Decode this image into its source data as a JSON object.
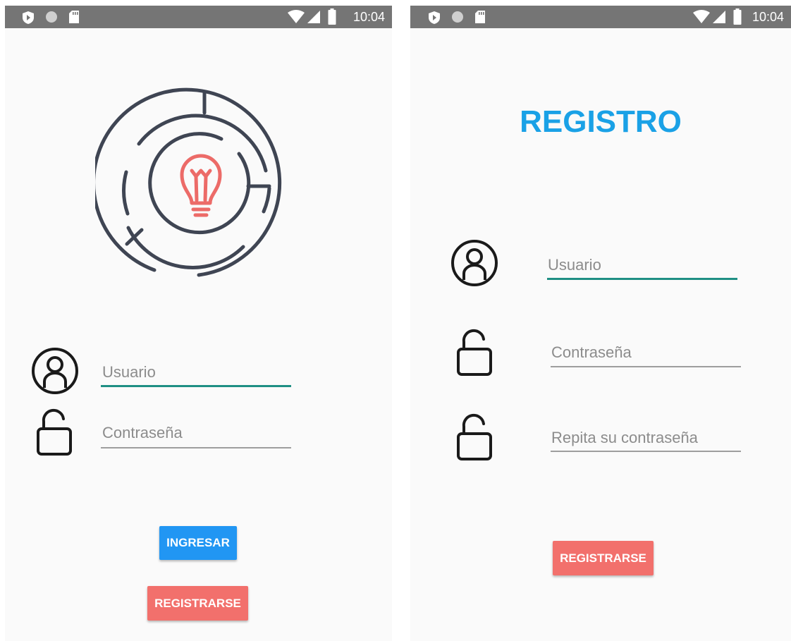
{
  "status_bar": {
    "time": "10:04"
  },
  "login": {
    "username_placeholder": "Usuario",
    "password_placeholder": "Contraseña",
    "login_button": "INGRESAR",
    "register_button": "REGISTRARSE"
  },
  "register": {
    "title": "REGISTRO",
    "username_placeholder": "Usuario",
    "password_placeholder": "Contraseña",
    "repeat_password_placeholder": "Repita su contraseña",
    "register_button": "REGISTRARSE"
  },
  "colors": {
    "status_bar": "#757575",
    "background": "#fafafa",
    "accent_teal": "#1f8f84",
    "primary_blue": "#2196f3",
    "salmon": "#f2706c",
    "title_blue": "#1aa1e6",
    "maze_dark": "#3f4553",
    "bulb_red": "#ec6b68"
  },
  "icons": [
    "shield-icon",
    "circle-icon",
    "sd-card-icon",
    "wifi-icon",
    "signal-icon",
    "battery-icon",
    "maze-logo",
    "lightbulb-icon",
    "user-icon",
    "lock-icon"
  ]
}
